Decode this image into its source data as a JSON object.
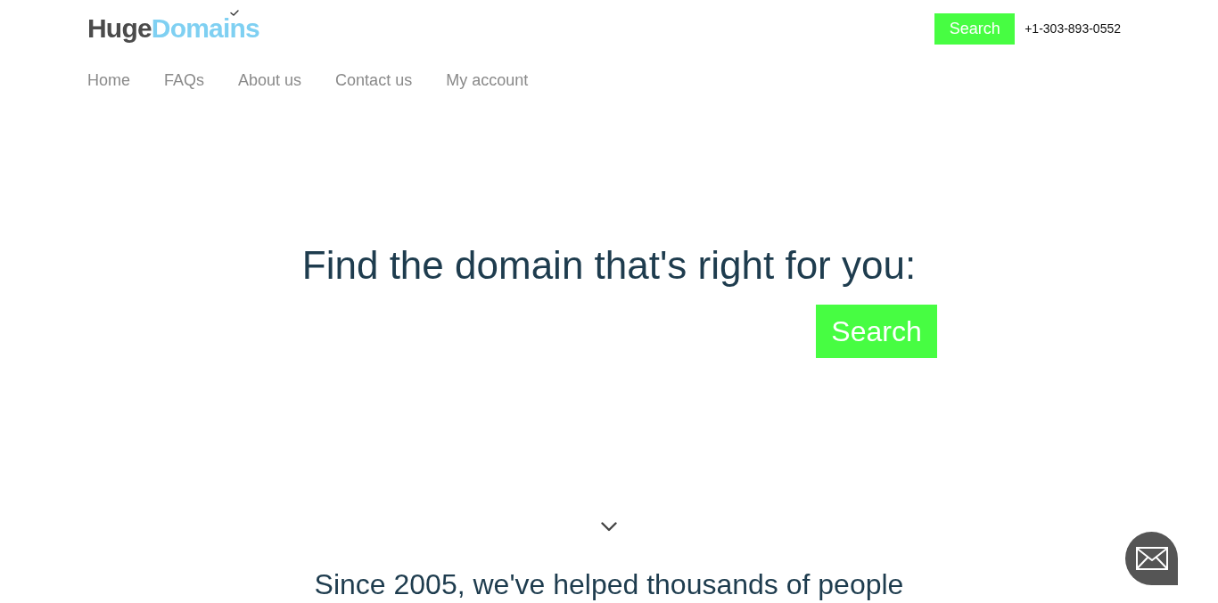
{
  "header": {
    "logo": {
      "dark_part": "Huge",
      "light_part": "Domains"
    },
    "search_button": "Search",
    "phone": "+1-303-893-0552"
  },
  "nav": {
    "items": [
      {
        "label": "Home"
      },
      {
        "label": "FAQs"
      },
      {
        "label": "About us"
      },
      {
        "label": "Contact us"
      },
      {
        "label": "My account"
      }
    ]
  },
  "hero": {
    "headline": "Find the domain that's right for you:",
    "search_button": "Search"
  },
  "next_section": {
    "heading": "Since 2005, we've helped thousands of people"
  }
}
